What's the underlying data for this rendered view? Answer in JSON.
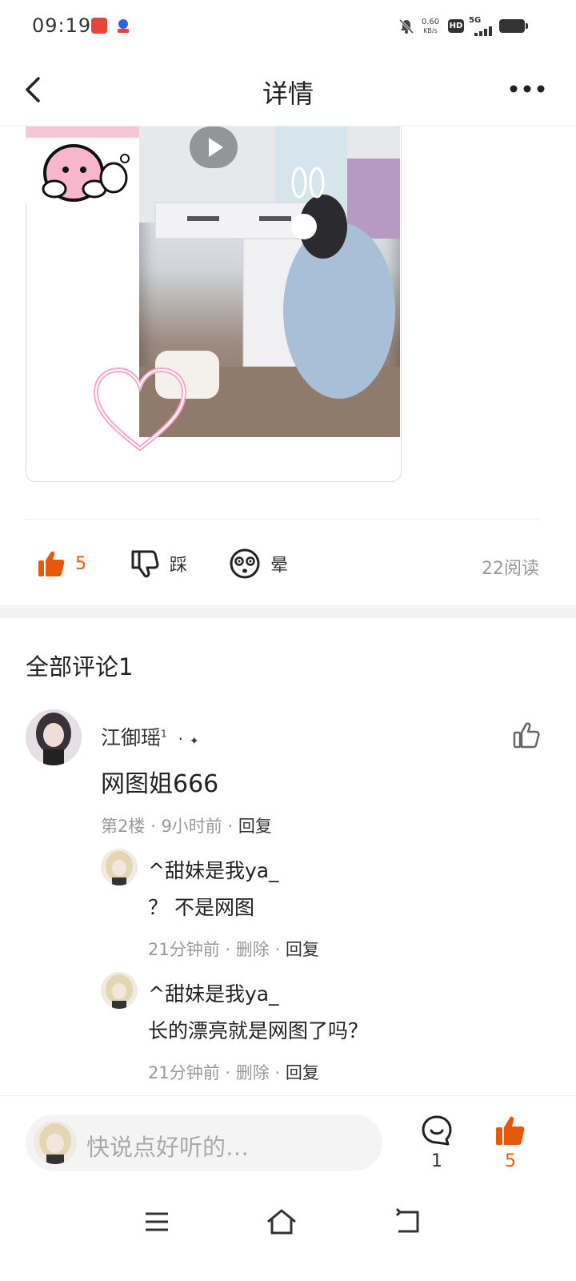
{
  "status_bar": {
    "time": "09:19",
    "net_speed_value": "0.60",
    "net_speed_unit": "KB/s",
    "hd_label": "HD",
    "signal_label": "5G",
    "icons": [
      "app-icon-red",
      "app-icon-baidu",
      "mute-bell-icon",
      "signal-icon",
      "battery-icon"
    ]
  },
  "header": {
    "title": "详情",
    "back_icon": "chevron-left-icon",
    "more_icon": "more-dots-icon"
  },
  "post": {
    "media": {
      "has_video_play": true,
      "play_icon": "play-icon"
    },
    "actions": {
      "like_count": "5",
      "dislike_label": "踩",
      "dizzy_label": "晕",
      "read_count": "22阅读"
    }
  },
  "comments": {
    "section_title": "全部评论1",
    "items": [
      {
        "username": "江御瑶",
        "level": "1",
        "name_suffix": "·",
        "text": "网图姐666",
        "floor": "第2楼",
        "time": "9小时前",
        "reply_label": "回复",
        "sep": "·",
        "replies": [
          {
            "username": "^甜妹是我ya_",
            "text": "？ 不是网图",
            "time": "21分钟前",
            "delete_label": "删除",
            "reply_label": "回复"
          },
          {
            "username": "^甜妹是我ya_",
            "text": "长的漂亮就是网图了吗？",
            "time": "21分钟前",
            "delete_label": "删除",
            "reply_label": "回复"
          }
        ]
      }
    ]
  },
  "bottom_bar": {
    "input_placeholder": "快说点好听的…",
    "comment_count": "1",
    "like_count": "5"
  },
  "colors": {
    "accent": "#e8580c",
    "text": "#222222",
    "muted": "#999999",
    "divider": "#eeeeee"
  }
}
